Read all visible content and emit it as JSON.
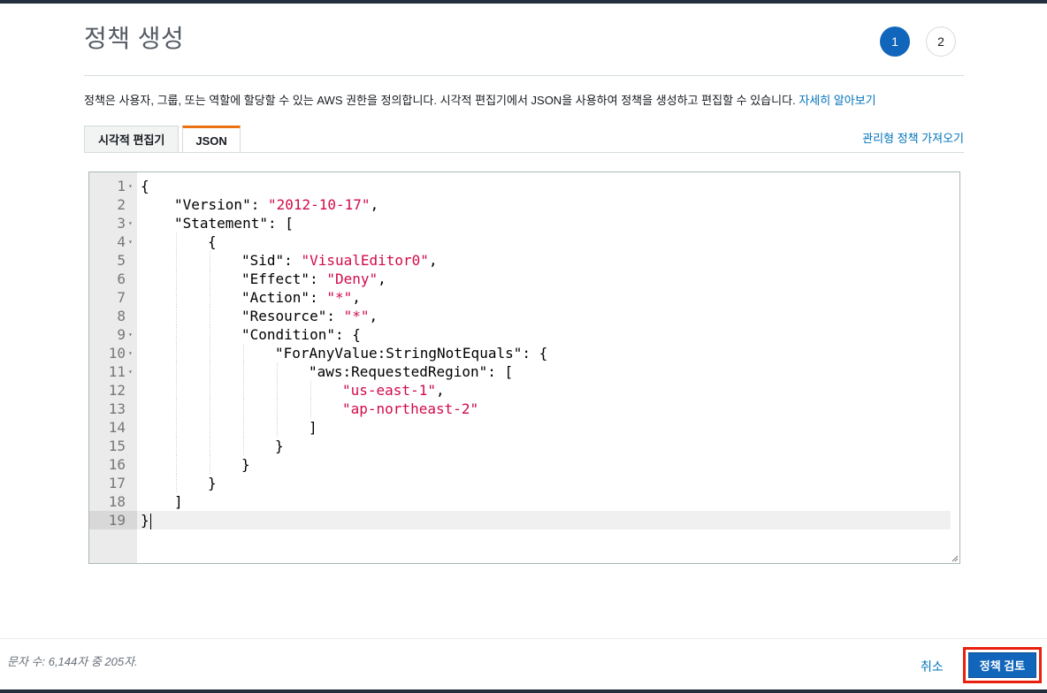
{
  "page": {
    "title": "정책 생성",
    "steps": [
      "1",
      "2"
    ],
    "description": "정책은 사용자, 그룹, 또는 역할에 할당할 수 있는 AWS 권한을 정의합니다. 시각적 편집기에서 JSON을 사용하여 정책을 생성하고 편집할 수 있습니다.",
    "learn_more": "자세히 알아보기"
  },
  "tabs": [
    {
      "label": "시각적 편집기",
      "selected": false
    },
    {
      "label": "JSON",
      "selected": true
    }
  ],
  "import_managed_policy": "관리형 정책 가져오기",
  "editor": {
    "lines": [
      {
        "n": "1",
        "fold": true,
        "indent": 0,
        "parts": [
          {
            "t": "{"
          }
        ]
      },
      {
        "n": "2",
        "fold": false,
        "indent": 1,
        "parts": [
          {
            "t": "\"Version\": "
          },
          {
            "t": "\"2012-10-17\"",
            "s": true
          },
          {
            "t": ","
          }
        ]
      },
      {
        "n": "3",
        "fold": true,
        "indent": 1,
        "parts": [
          {
            "t": "\"Statement\": ["
          }
        ]
      },
      {
        "n": "4",
        "fold": true,
        "indent": 2,
        "parts": [
          {
            "t": "{"
          }
        ]
      },
      {
        "n": "5",
        "fold": false,
        "indent": 3,
        "parts": [
          {
            "t": "\"Sid\": "
          },
          {
            "t": "\"VisualEditor0\"",
            "s": true
          },
          {
            "t": ","
          }
        ]
      },
      {
        "n": "6",
        "fold": false,
        "indent": 3,
        "parts": [
          {
            "t": "\"Effect\": "
          },
          {
            "t": "\"Deny\"",
            "s": true
          },
          {
            "t": ","
          }
        ]
      },
      {
        "n": "7",
        "fold": false,
        "indent": 3,
        "parts": [
          {
            "t": "\"Action\": "
          },
          {
            "t": "\"*\"",
            "s": true
          },
          {
            "t": ","
          }
        ]
      },
      {
        "n": "8",
        "fold": false,
        "indent": 3,
        "parts": [
          {
            "t": "\"Resource\": "
          },
          {
            "t": "\"*\"",
            "s": true
          },
          {
            "t": ","
          }
        ]
      },
      {
        "n": "9",
        "fold": true,
        "indent": 3,
        "parts": [
          {
            "t": "\"Condition\": {"
          }
        ]
      },
      {
        "n": "10",
        "fold": true,
        "indent": 4,
        "parts": [
          {
            "t": "\"ForAnyValue:StringNotEquals\": {"
          }
        ]
      },
      {
        "n": "11",
        "fold": true,
        "indent": 5,
        "parts": [
          {
            "t": "\"aws:RequestedRegion\": ["
          }
        ]
      },
      {
        "n": "12",
        "fold": false,
        "indent": 6,
        "parts": [
          {
            "t": "\"us-east-1\"",
            "s": true
          },
          {
            "t": ","
          }
        ]
      },
      {
        "n": "13",
        "fold": false,
        "indent": 6,
        "parts": [
          {
            "t": "\"ap-northeast-2\"",
            "s": true
          }
        ]
      },
      {
        "n": "14",
        "fold": false,
        "indent": 5,
        "parts": [
          {
            "t": "]"
          }
        ]
      },
      {
        "n": "15",
        "fold": false,
        "indent": 4,
        "parts": [
          {
            "t": "}"
          }
        ]
      },
      {
        "n": "16",
        "fold": false,
        "indent": 3,
        "parts": [
          {
            "t": "}"
          }
        ]
      },
      {
        "n": "17",
        "fold": false,
        "indent": 2,
        "parts": [
          {
            "t": "}"
          }
        ]
      },
      {
        "n": "18",
        "fold": false,
        "indent": 1,
        "parts": [
          {
            "t": "]"
          }
        ]
      },
      {
        "n": "19",
        "fold": false,
        "indent": 0,
        "current": true,
        "parts": [
          {
            "t": "}"
          }
        ]
      }
    ]
  },
  "footer": {
    "char_count": "문자 수: 6,144자 중 205자.",
    "cancel": "취소",
    "review": "정책 검토"
  },
  "colors": {
    "primary": "#1166bb",
    "link": "#0073bb",
    "string": "#d10a49",
    "highlight_outline": "#e8200e",
    "tab_accent": "#ec7211"
  }
}
